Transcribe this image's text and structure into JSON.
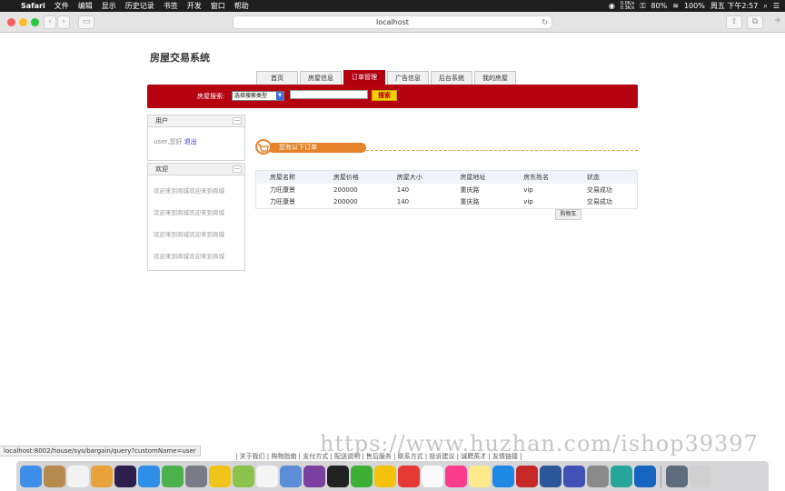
{
  "menubar": {
    "app_name": "Safari",
    "menus": [
      "文件",
      "编辑",
      "显示",
      "历史记录",
      "书签",
      "开发",
      "窗口",
      "帮助"
    ],
    "net_up": "0.0K/s",
    "net_down": "0.3K/s",
    "battery": "80%",
    "wifi": "100%",
    "clock": "周五 下午2:57"
  },
  "browser": {
    "url": "localhost"
  },
  "site": {
    "title": "房屋交易系统",
    "tabs": [
      "首页",
      "房屋信息",
      "订单管理",
      "广告信息",
      "后台系统",
      "我的房屋"
    ],
    "active_tab": 2
  },
  "search": {
    "label": "房屋搜索:",
    "select_value": "选择搜索类型",
    "button": "搜索"
  },
  "user_panel": {
    "title": "用户",
    "greeting": "user,您好",
    "logout": "退出"
  },
  "welcome_panel": {
    "title": "欢迎",
    "lines": [
      "欢迎来到商城欢迎来到商城",
      "欢迎来到商城欢迎来到商城",
      "欢迎来到商城欢迎来到商城",
      "欢迎来到商城欢迎来到商城"
    ]
  },
  "orders": {
    "banner": "您有以下订单",
    "headers": [
      "房屋名称",
      "房屋价格",
      "房屋大小",
      "房屋地址",
      "房东姓名",
      "状态"
    ],
    "rows": [
      [
        "力旺康景",
        "200000",
        "140",
        "重庆路",
        "vip",
        "交易成功"
      ],
      [
        "力旺康景",
        "200000",
        "140",
        "重庆路",
        "vip",
        "交易成功"
      ]
    ],
    "cart_button": "购物车"
  },
  "statusbar": {
    "url": "localhost:8002/house/sys/bargain/query?customName=user"
  },
  "footer": {
    "text": "| 关于我们 | 购物指南 | 支付方式 | 配送说明 | 售后服务 | 联系方式 | 投诉建议 | 诚聘英才 | 友情链接 |"
  },
  "watermark": "https://www.huzhan.com/ishop39397",
  "colors": {
    "brand_red": "#b4000f",
    "accent_orange": "#e6832a",
    "search_yellow": "#f5d000"
  }
}
